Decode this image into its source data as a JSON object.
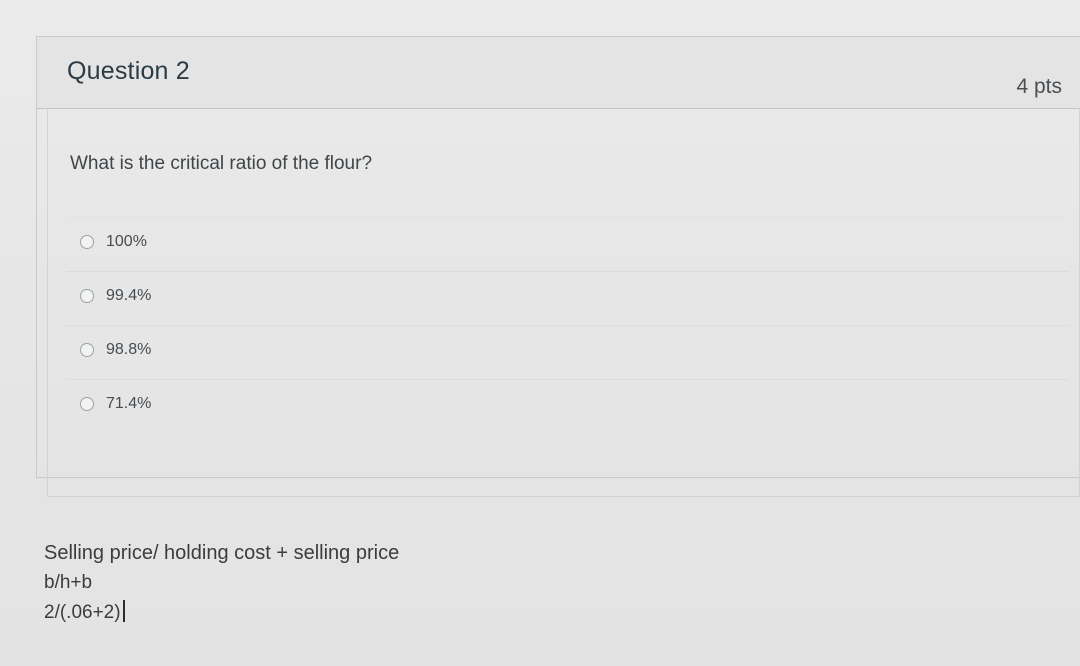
{
  "question": {
    "title": "Question 2",
    "points": "4 pts",
    "text": "What is the critical ratio of the flour?",
    "answers": [
      {
        "label": "100%",
        "selected": false
      },
      {
        "label": "99.4%",
        "selected": false
      },
      {
        "label": "98.8%",
        "selected": false
      },
      {
        "label": "71.4%",
        "selected": false
      }
    ]
  },
  "notes": {
    "line1": "Selling price/ holding cost + selling price",
    "line2": "b/h+b",
    "line3": "2/(.06+2)"
  }
}
